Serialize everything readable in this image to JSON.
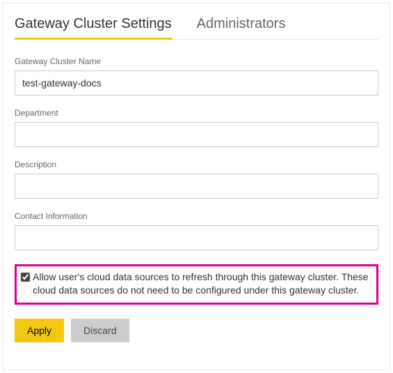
{
  "tabs": [
    {
      "label": "Gateway Cluster Settings",
      "active": true
    },
    {
      "label": "Administrators",
      "active": false
    }
  ],
  "fields": {
    "name": {
      "label": "Gateway Cluster Name",
      "value": "test-gateway-docs"
    },
    "department": {
      "label": "Department",
      "value": ""
    },
    "description": {
      "label": "Description",
      "value": ""
    },
    "contact": {
      "label": "Contact Information",
      "value": ""
    }
  },
  "checkbox": {
    "checked": true,
    "label": "Allow user's cloud data sources to refresh through this gateway cluster. These cloud data sources do not need to be configured under this gateway cluster."
  },
  "buttons": {
    "apply": "Apply",
    "discard": "Discard"
  }
}
